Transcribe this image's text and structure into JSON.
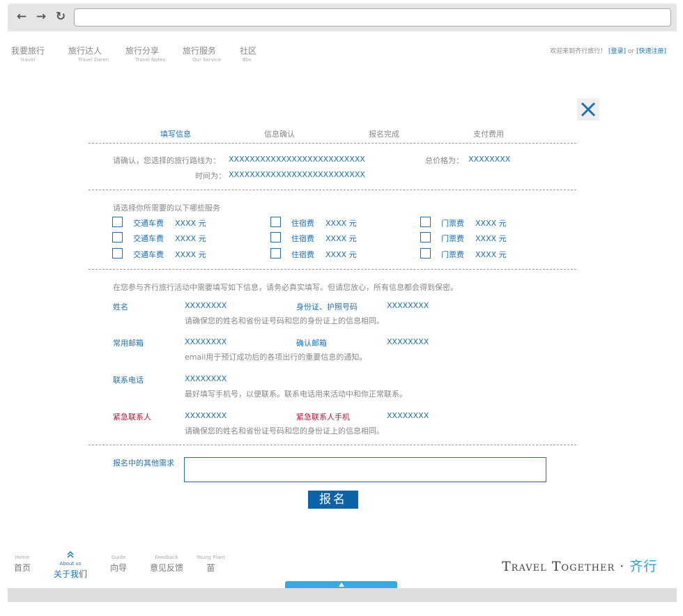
{
  "topnav": [
    {
      "cn": "我要旅行",
      "en": "travel"
    },
    {
      "cn": "旅行达人",
      "en": "Travel Daren"
    },
    {
      "cn": "旅行分享",
      "en": "Travel Notes"
    },
    {
      "cn": "旅行服务",
      "en": "Our Service"
    },
    {
      "cn": "社区",
      "en": "Bbs"
    }
  ],
  "welcome": {
    "text": "欢迎来到齐行旅行！",
    "login": "[登录]",
    "or": " or ",
    "register": "[快速注册]"
  },
  "steps": [
    "填写信息",
    "信息确认",
    "报名完成",
    "支付费用"
  ],
  "route": {
    "confirm_label": "请确认，您选择的旅行路线为：",
    "route_value": "XXXXXXXXXXXXXXXXXXXXXXXXXX",
    "price_label": "总价格为：",
    "price_value": "XXXXXXXX",
    "time_label": "时间为：",
    "time_value": "XXXXXXXXXXXXXXXXXXXXXXXXXX"
  },
  "services": {
    "title": "请选择你所需要的以下哪些服务",
    "rows": [
      [
        {
          "name": "交通车费",
          "price": "XXXX 元"
        },
        {
          "name": "住宿费",
          "price": "XXXX 元"
        },
        {
          "name": "门票费",
          "price": "XXXX 元"
        }
      ],
      [
        {
          "name": "交通车费",
          "price": "XXXX 元"
        },
        {
          "name": "住宿费",
          "price": "XXXX 元"
        },
        {
          "name": "门票费",
          "price": "XXXX 元"
        }
      ],
      [
        {
          "name": "交通车费",
          "price": "XXXX 元"
        },
        {
          "name": "住宿费",
          "price": "XXXX 元"
        },
        {
          "name": "门票费",
          "price": "XXXX 元"
        }
      ]
    ]
  },
  "info": {
    "intro": "在您参与齐行旅行活动中需要填写如下信息，请务必真实填写。但请您放心，所有信息都会得到保密。",
    "name_label": "姓名",
    "name_value": "XXXXXXXX",
    "id_label": "身份证、护照号码",
    "id_value": "XXXXXXXX",
    "id_hint": "请确保您的姓名和省份证号码和您的身份证上的信息相同。",
    "email_label": "常用邮箱",
    "email_value": "XXXXXXXX",
    "email_confirm_label": "确认邮箱",
    "email_confirm_value": "XXXXXXXX",
    "email_hint": "email用于预订成功后的各项出行的重要信息的通知。",
    "phone_label": "联系电话",
    "phone_value": "XXXXXXXX",
    "phone_hint": "最好填写手机号，以便联系。联系电话用来活动中和你正常联系。",
    "emergency_label": "紧急联系人",
    "emergency_value": "XXXXXXXX",
    "emergency_phone_label": "紧急联系人手机",
    "emergency_phone_value": "XXXXXXXX",
    "emergency_hint": "请确保您的姓名和省份证号码和您的身份证上的信息相同。"
  },
  "other": {
    "label": "报名中的其他需求",
    "value": ""
  },
  "submit_label": "报名",
  "footer": [
    {
      "en": "Home",
      "cn": "首页"
    },
    {
      "en": "About us",
      "cn": "关于我们"
    },
    {
      "en": "Guide",
      "cn": "向导"
    },
    {
      "en": "Feedback",
      "cn": "意见反馈"
    },
    {
      "en": "Young Plant",
      "cn": "苗"
    }
  ],
  "brand": {
    "en": "Travel Together",
    "dot": " · ",
    "cn": "齐行"
  },
  "colors": {
    "accent": "#1e6fb8",
    "alert": "#c8102e",
    "button": "#0d62a8"
  }
}
